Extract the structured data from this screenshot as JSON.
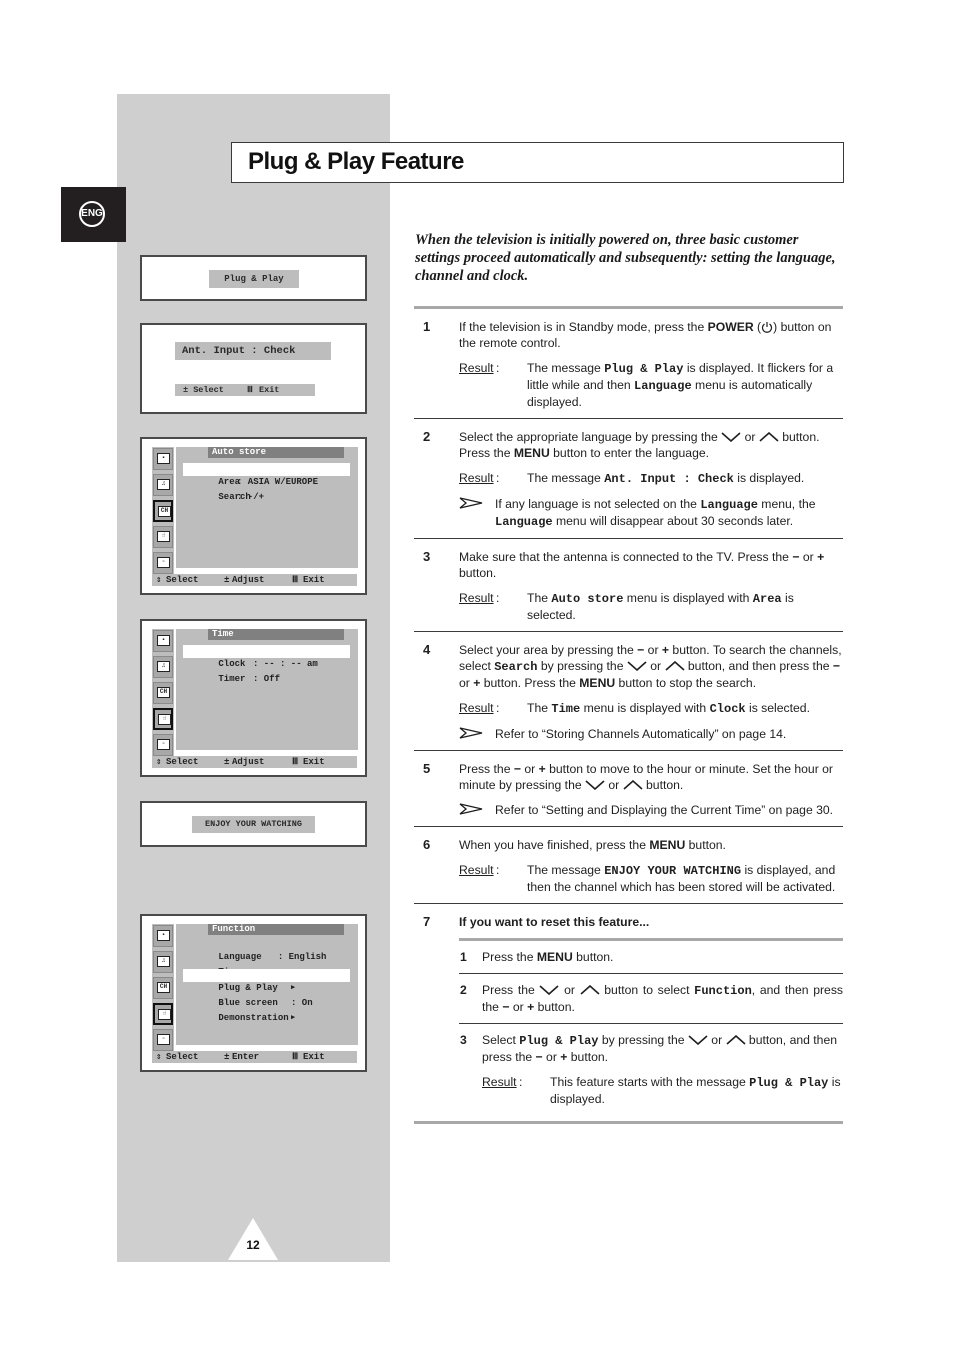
{
  "page": {
    "title": "Plug & Play Feature",
    "language_tab": "ENG",
    "page_number": "12",
    "intro": "When the television is initially powered on, three basic customer settings proceed automatically and subsequently: setting the language, channel and clock."
  },
  "screens": {
    "plug_play": {
      "message": "Plug & Play"
    },
    "ant_input": {
      "message": "Ant. Input : Check",
      "foot_select": "± Select",
      "foot_exit": "Exit"
    },
    "auto_store": {
      "title": "Auto store",
      "rows": [
        {
          "label": "Area",
          "value": ": ASIA W/EUROPE",
          "selected": true
        },
        {
          "label": "Search",
          "value": ": -/+",
          "selected": false
        }
      ],
      "foot": {
        "select": "Select",
        "adjust": "Adjust",
        "exit": "Exit"
      }
    },
    "time": {
      "title": "Time",
      "rows": [
        {
          "label": "Clock",
          "value": ": -- : -- am",
          "selected": true
        },
        {
          "label": "Timer",
          "value": ": Off",
          "selected": false
        }
      ],
      "foot": {
        "select": "Select",
        "adjust": "Adjust",
        "exit": "Exit"
      }
    },
    "enjoy": {
      "message": "ENJOY YOUR WATCHING"
    },
    "function": {
      "title": "Function",
      "rows": [
        {
          "label": "Language   : English",
          "value": "",
          "arrow": false,
          "selected": false
        },
        {
          "label": "Time",
          "value": "",
          "arrow": true,
          "selected": false
        },
        {
          "label": "Plug & Play",
          "value": "",
          "arrow": true,
          "selected": true
        },
        {
          "label": "Blue screen",
          "value": ": On",
          "arrow": false,
          "selected": false
        },
        {
          "label": "Demonstration",
          "value": "",
          "arrow": true,
          "selected": false
        }
      ],
      "foot": {
        "select": "Select",
        "enter": "Enter",
        "exit": "Exit"
      }
    },
    "side_icons": [
      "tv-picture-icon",
      "sound-icon",
      "channel-icon",
      "function-hand-icon",
      "pip-icon"
    ]
  },
  "labels": {
    "result": "Result",
    "or": "or",
    "button": "button"
  },
  "steps": {
    "s1": {
      "num": "1",
      "t1": "If the television is in Standby mode, press the ",
      "power": "POWER",
      "t2": " (",
      "t3": ") button on the remote control.",
      "r1": "The message ",
      "r_code1": "Plug & Play",
      "r2": " is displayed. It flickers for a little while and then ",
      "r_code2": "Language",
      "r3": " menu is automatically displayed."
    },
    "s2": {
      "num": "2",
      "t1": "Select the appropriate language by pressing the ",
      "t2": " or ",
      "t3": " button. Press the ",
      "menu": "MENU",
      "t4": " button to enter the language.",
      "r1": "The message ",
      "r_code": "Ant. Input : Check",
      "r2": " is displayed.",
      "n1": "If any language is not selected on the ",
      "n_code1": "Language",
      "n2": " menu, the ",
      "n_code2": "Language",
      "n3": " menu will disappear about 30 seconds later."
    },
    "s3": {
      "num": "3",
      "t1": "Make sure that the antenna is connected to the TV. Press the ",
      "minus": "−",
      "t2": " or ",
      "plus": "+",
      "t3": " button.",
      "r1": "The ",
      "r_code1": "Auto store",
      "r2": " menu is displayed with ",
      "r_code2": "Area",
      "r3": " is selected."
    },
    "s4": {
      "num": "4",
      "t1": "Select your area by pressing the ",
      "t2": " or ",
      "t3": " button. To search the channels, select ",
      "code_search": "Search",
      "t4": " by pressing the ",
      "t5": " or ",
      "t6": " button, and then press the ",
      "t7": " or ",
      "t8": " button. Press the ",
      "menu": "MENU",
      "t9": " button to stop the search.",
      "r1": "The ",
      "r_code1": "Time",
      "r2": " menu is displayed with ",
      "r_code2": "Clock",
      "r3": " is selected.",
      "note": "Refer to “Storing Channels Automatically” on page 14."
    },
    "s5": {
      "num": "5",
      "t1": "Press the ",
      "t2": " or ",
      "t3": " button to move to the hour or minute. Set the hour or minute by pressing the ",
      "t4": " or ",
      "t5": " button.",
      "note": "Refer to “Setting and Displaying the Current Time” on page 30."
    },
    "s6": {
      "num": "6",
      "t1": "When you have finished, press the ",
      "menu": "MENU",
      "t2": " button.",
      "r1": "The message ",
      "r_code": "ENJOY YOUR WATCHING",
      "r2": " is displayed, and then the channel which has been stored will be activated."
    },
    "s7": {
      "num": "7",
      "heading": "If you want to reset this feature...",
      "sub1": {
        "num": "1",
        "t1": "Press the ",
        "menu": "MENU",
        "t2": " button."
      },
      "sub2": {
        "num": "2",
        "t1": "Press the ",
        "t2": " or ",
        "t3": " button to select ",
        "code": "Function",
        "t4": ", and then press the ",
        "t5": " or ",
        "t6": " button."
      },
      "sub3": {
        "num": "3",
        "t1": "Select ",
        "code": "Plug & Play",
        "t2": " by pressing the ",
        "t3": " or ",
        "t4": " button, and then press the ",
        "t5": " or ",
        "t6": " button.",
        "r1": "This feature starts with the message ",
        "r_code": "Plug & Play",
        "r2": " is displayed."
      }
    }
  }
}
